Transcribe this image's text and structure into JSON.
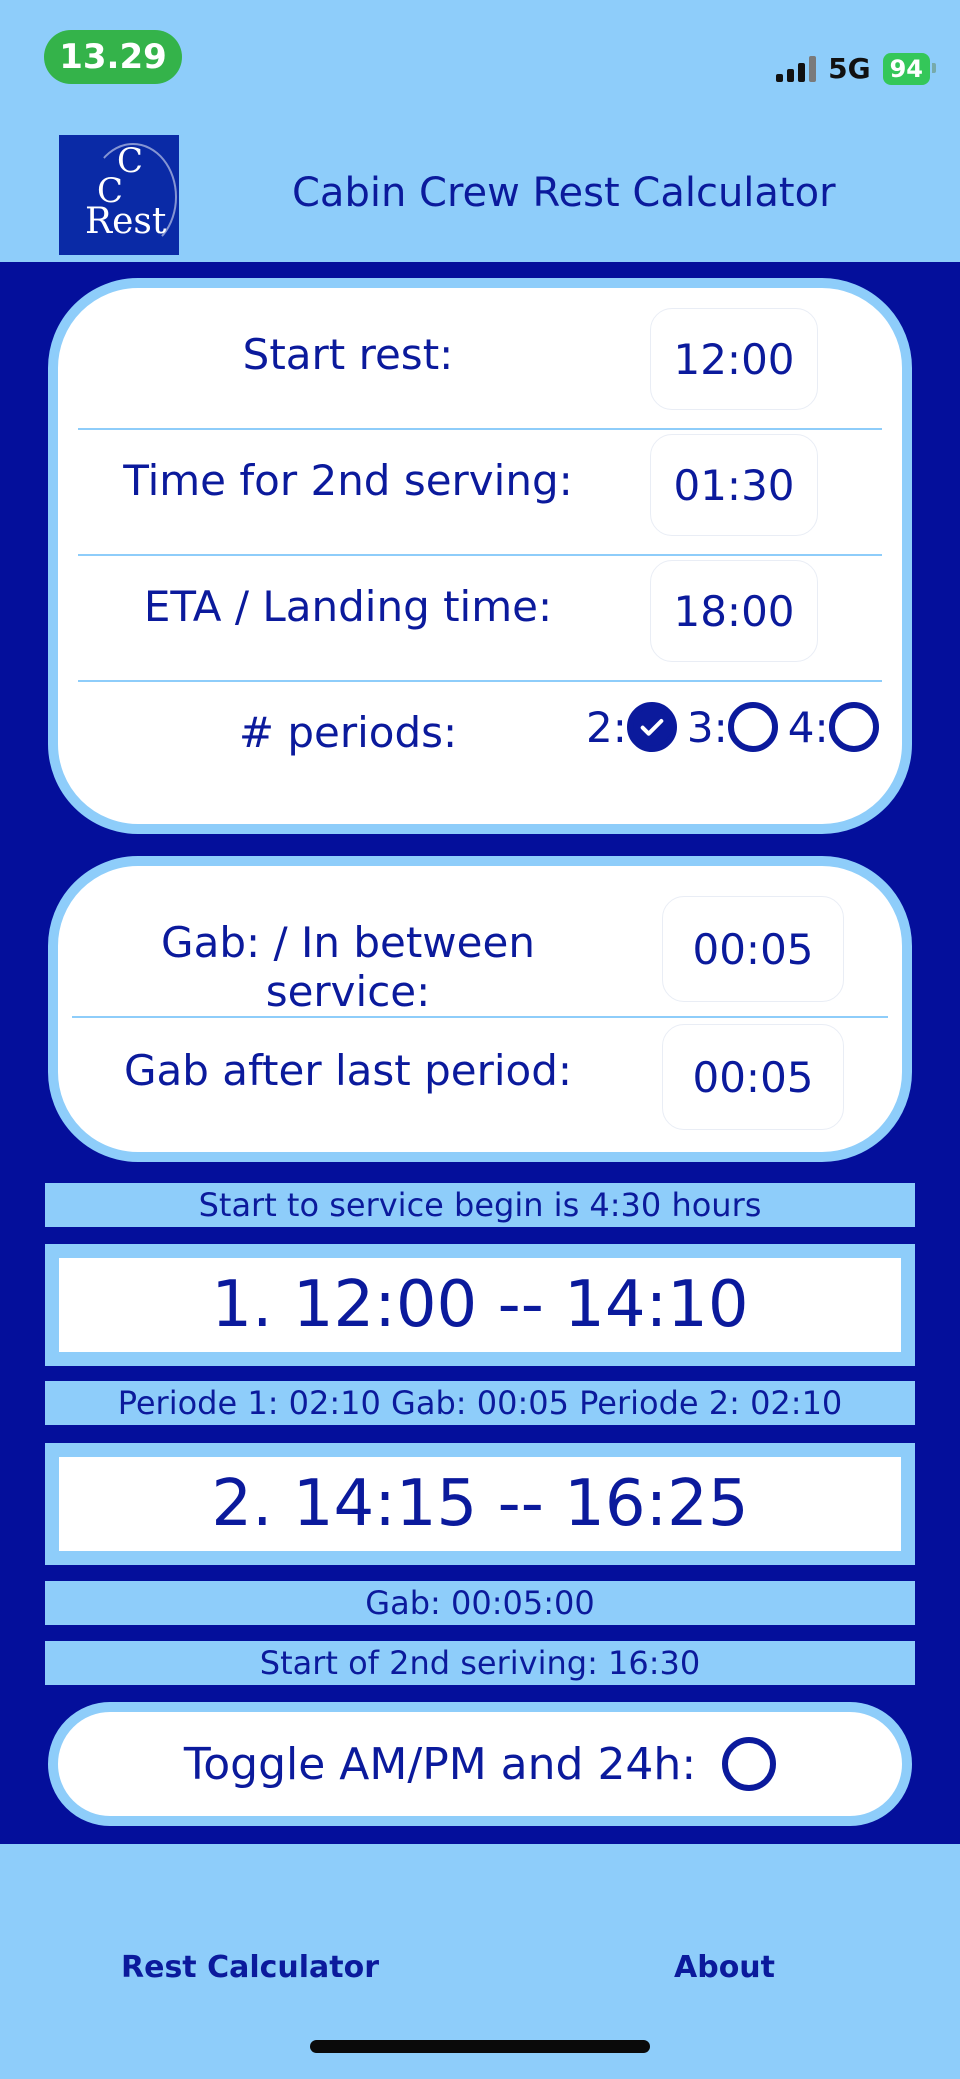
{
  "status_bar": {
    "time": "13.29",
    "network": "5G",
    "battery": "94"
  },
  "header": {
    "logo": {
      "c1": "C",
      "c2": "C",
      "rest": "Rest"
    },
    "title": "Cabin Crew Rest Calculator"
  },
  "inputs": {
    "start_rest": {
      "label": "Start rest:",
      "value": "12:00"
    },
    "second_serving": {
      "label": "Time for 2nd serving:",
      "value": "01:30"
    },
    "eta": {
      "label": "ETA / Landing time:",
      "value": "18:00"
    },
    "periods": {
      "label": "# periods:",
      "options": [
        {
          "label": "2:",
          "checked": true
        },
        {
          "label": "3:",
          "checked": false
        },
        {
          "label": "4:",
          "checked": false
        }
      ]
    }
  },
  "gaps": {
    "between": {
      "label": "Gab: / In between service:",
      "value": "00:05"
    },
    "after_last": {
      "label": "Gab after last period:",
      "value": "00:05"
    }
  },
  "results": {
    "summary": "Start to service begin is 4:30 hours",
    "period1": "1.  12:00 -- 14:10",
    "detail": "Periode 1: 02:10   Gab: 00:05   Periode 2: 02:10",
    "period2": "2.  14:15 -- 16:25",
    "gab": "Gab: 00:05:00",
    "second_serving": "Start of 2nd seriving: 16:30"
  },
  "toggle": {
    "label": "Toggle AM/PM and 24h:",
    "on": false
  },
  "tabs": {
    "rest_calculator": "Rest Calculator",
    "about": "About"
  },
  "colors": {
    "light_blue": "#8ecdfa",
    "dark_blue": "#040f9b",
    "text_blue": "#0b1a9c",
    "status_green": "#34b34a"
  }
}
